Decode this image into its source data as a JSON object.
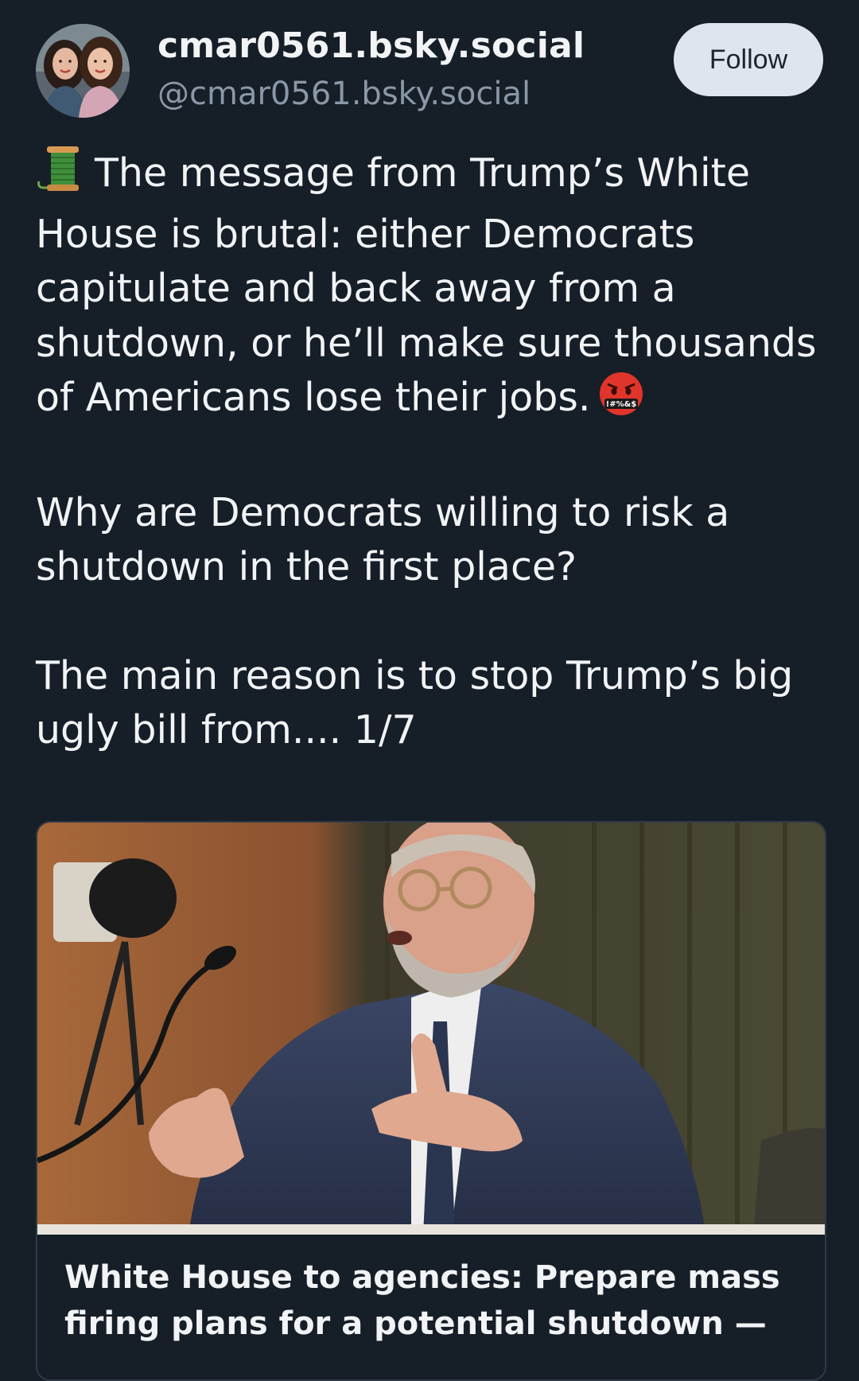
{
  "author": {
    "display_name": "cmar0561.bsky.social",
    "handle": "@cmar0561.bsky.social",
    "avatar_icon": "avatar-two-women-photo"
  },
  "follow_button": {
    "label": "Follow"
  },
  "post": {
    "lead_emoji": "spool-of-thread",
    "paragraph_1": "The message from Trump’s White House is brutal: either Democrats capitulate and back away from a shutdown, or he’ll make sure thousands of Americans lose their jobs.",
    "trailing_emoji": "face-with-symbols-on-mouth",
    "paragraph_2": "Why are Democrats willing to risk a shutdown in the first place?",
    "paragraph_3": "The main reason is to stop Trump’s big ugly bill from....  1/7"
  },
  "link_card": {
    "image_description_icon": "hearing-photo",
    "title": "White House to agencies: Prepare mass firing plans for a potential shutdown —"
  },
  "colors": {
    "background": "#161e27",
    "text": "#f1f3f5",
    "muted": "#8a98a8",
    "follow_bg": "#dfe5ec",
    "card_border": "#2e3a47"
  }
}
